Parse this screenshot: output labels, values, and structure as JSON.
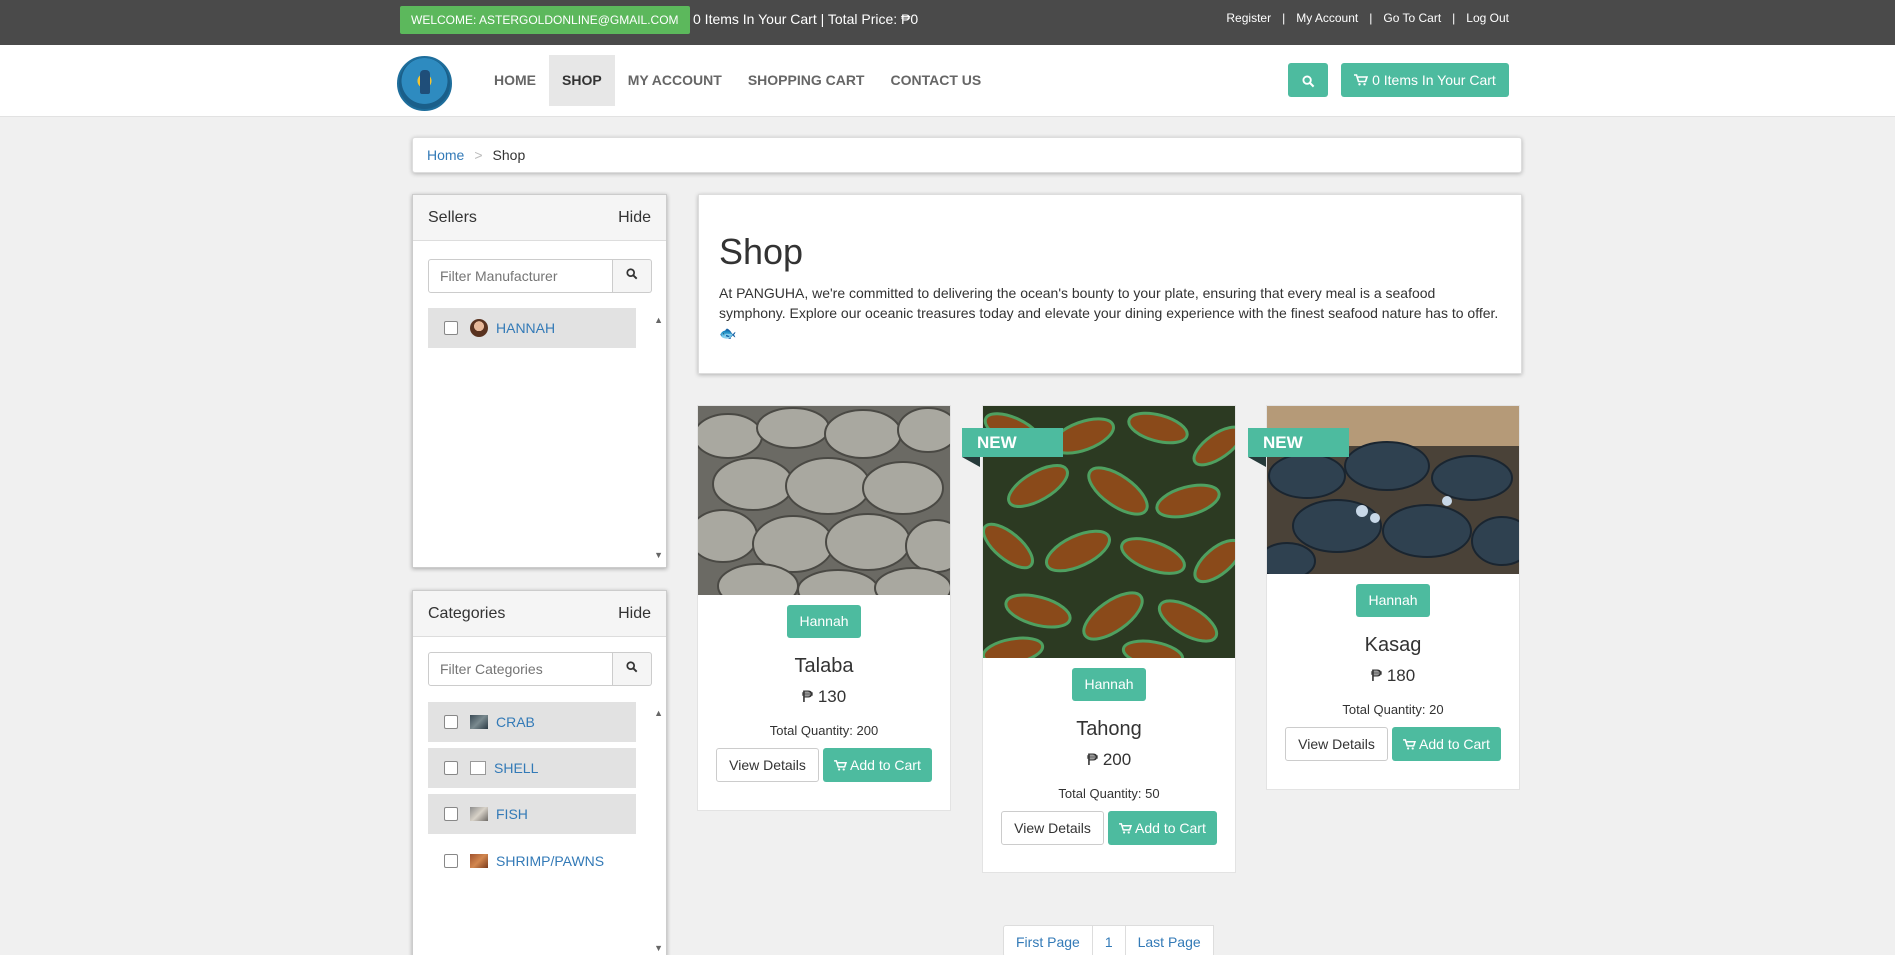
{
  "topbar": {
    "welcome": "WELCOME: ASTERGOLDONLINE@GMAIL.COM",
    "cart_summary": "0 Items In Your Cart | Total Price: ₱0",
    "links": [
      "Register",
      "My Account",
      "Go To Cart",
      "Log Out"
    ]
  },
  "nav": {
    "items": [
      "HOME",
      "SHOP",
      "MY ACCOUNT",
      "SHOPPING CART",
      "CONTACT US"
    ],
    "cart_button": "0 Items In Your Cart"
  },
  "breadcrumb": {
    "home": "Home",
    "separator": ">",
    "current": "Shop"
  },
  "sellers": {
    "title": "Sellers",
    "hide": "Hide",
    "placeholder": "Filter Manufacturer",
    "items": [
      {
        "label": "HANNAH"
      }
    ]
  },
  "categories": {
    "title": "Categories",
    "hide": "Hide",
    "placeholder": "Filter Categories",
    "items": [
      {
        "label": "CRAB"
      },
      {
        "label": "SHELL"
      },
      {
        "label": "FISH"
      },
      {
        "label": "SHRIMP/PAWNS"
      }
    ]
  },
  "shop": {
    "title": "Shop",
    "description": "At PANGUHA, we're committed to delivering the ocean's bounty to your plate, ensuring that every meal is a seafood symphony. Explore our oceanic treasures today and elevate your dining experience with the finest seafood nature has to offer. 🐟"
  },
  "products": [
    {
      "seller": "Hannah",
      "name": "Talaba",
      "price": "₱ 130",
      "quantity": "Total Quantity: 200",
      "badge": "",
      "view": "View Details",
      "add": "Add to Cart"
    },
    {
      "seller": "Hannah",
      "name": "Tahong",
      "price": "₱ 200",
      "quantity": "Total Quantity: 50",
      "badge": "NEW",
      "view": "View Details",
      "add": "Add to Cart"
    },
    {
      "seller": "Hannah",
      "name": "Kasag",
      "price": "₱ 180",
      "quantity": "Total Quantity: 20",
      "badge": "NEW",
      "view": "View Details",
      "add": "Add to Cart"
    }
  ],
  "pagination": {
    "first": "First Page",
    "page": "1",
    "last": "Last Page"
  },
  "colors": {
    "accent": "#4dbb9f",
    "topbar": "#4a4a4a",
    "welcome": "#5cb85c",
    "link": "#337ab7"
  }
}
